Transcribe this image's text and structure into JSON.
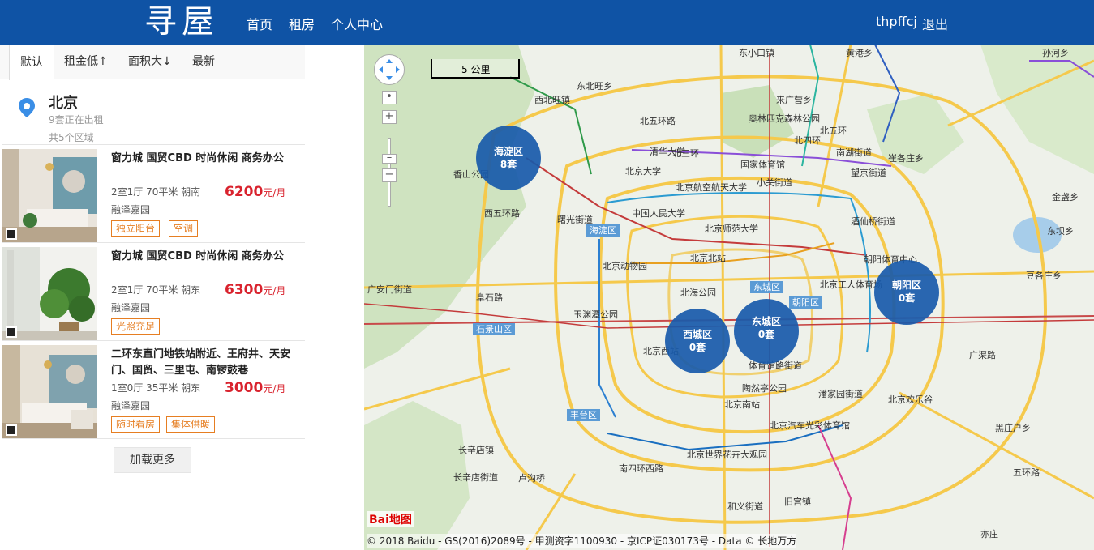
{
  "header": {
    "logo": "寻屋",
    "nav": [
      "首页",
      "租房",
      "个人中心"
    ],
    "username": "thpffcj",
    "logout": "退出"
  },
  "sort_tabs": [
    "默认",
    "租金低↑",
    "面积大↓",
    "最新"
  ],
  "city": {
    "name": "北京",
    "renting_count": "9套正在出租",
    "areas_count": "共5个区域",
    "pin_icon": "location-pin-icon"
  },
  "houses": [
    {
      "title": "窗力城 国贸CBD 时尚休闲 商务办公",
      "spec": "2室1厅 70平米 朝南",
      "community": "融泽嘉园",
      "price": "6200",
      "unit": "元/月",
      "tags": [
        "独立阳台",
        "空调"
      ]
    },
    {
      "title": "窗力城 国贸CBD 时尚休闲 商务办公",
      "spec": "2室1厅 70平米 朝东",
      "community": "融泽嘉园",
      "price": "6300",
      "unit": "元/月",
      "tags": [
        "光照充足"
      ]
    },
    {
      "title": "二环东直门地铁站附近、王府井、天安门、国贸、三里屯、南锣鼓巷",
      "spec": "1室0厅 35平米 朝东",
      "community": "融泽嘉园",
      "price": "3000",
      "unit": "元/月",
      "tags": [
        "随时看房",
        "集体供暖"
      ]
    }
  ],
  "load_more": "加载更多",
  "map": {
    "scale_label": "5 公里",
    "clusters": [
      {
        "name": "海淀区",
        "count": "8套"
      },
      {
        "name": "西城区",
        "count": "0套"
      },
      {
        "name": "东城区",
        "count": "0套"
      },
      {
        "name": "朝阳区",
        "count": "0套"
      }
    ],
    "district_boxes": [
      "海淀区",
      "石景山区",
      "丰台区",
      "东城区",
      "朝阳区"
    ],
    "labels": [
      "西北旺镇",
      "东北旺乡",
      "清华大学",
      "北京大学",
      "香山公园",
      "中国人民大学",
      "北京航空航天大学",
      "北京师范大学",
      "北京动物园",
      "北京北站",
      "北海公园",
      "北京西站",
      "北京南站",
      "陶然亭公园",
      "玉渊潭公园",
      "国家体育馆",
      "奥林匹克森林公园",
      "望京街道",
      "南湖街道",
      "酒仙桥街道",
      "朝阳体育中心",
      "北京工人体育场",
      "北京欢乐谷",
      "广渠路",
      "潘家园街道",
      "黑庄户乡",
      "豆各庄乡",
      "亦庄",
      "旧宫镇",
      "和义街道",
      "长辛店镇",
      "长辛店街道",
      "卢沟桥",
      "北京世界花卉大观园",
      "南四环西路",
      "北五环路",
      "北四环",
      "北三环",
      "广安门街道",
      "西五环路",
      "阜石路",
      "北京汽车光彩体育馆",
      "来广营乡",
      "崔各庄乡",
      "金盏乡",
      "东坝乡",
      "黄港乡",
      "孙河乡",
      "北五环",
      "五环路",
      "小关街道",
      "东小口镇",
      "体育馆路街道",
      "曙光街道"
    ],
    "baidu_logo": "Bai地图",
    "copyright": "© 2018 Baidu - GS(2016)2089号 - 甲测资字1100930 - 京ICP证030173号 - Data © 长地万方"
  }
}
